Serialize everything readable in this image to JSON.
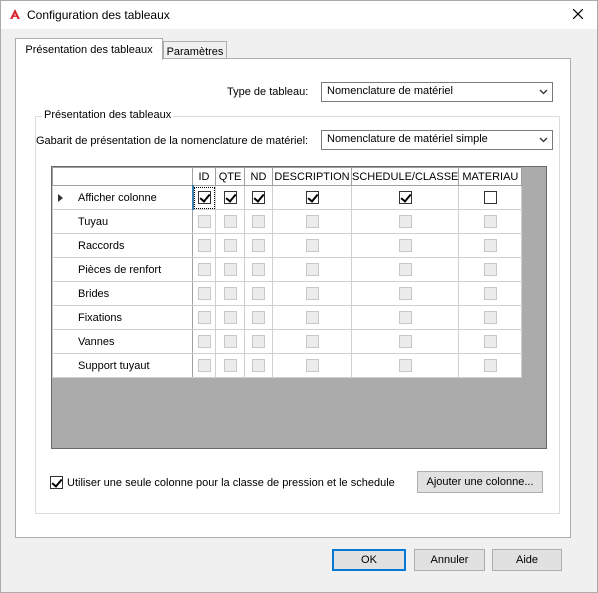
{
  "window": {
    "title": "Configuration des tableaux",
    "icon": "autocad-a-icon"
  },
  "tabs": [
    {
      "label": "Présentation des tableaux",
      "active": true
    },
    {
      "label": "Paramètres",
      "active": false
    }
  ],
  "table_type": {
    "label": "Type de tableau:",
    "value": "Nomenclature de matériel"
  },
  "group": {
    "legend": "Présentation des tableaux",
    "template_label": "Gabarit de présentation de la nomenclature de matériel:",
    "template_value": "Nomenclature de matériel simple"
  },
  "grid": {
    "columns": [
      "ID",
      "QTE",
      "ND",
      "DESCRIPTION",
      "SCHEDULE/CLASSE",
      "MATERIAU"
    ],
    "rows": [
      {
        "label": "Afficher colonne",
        "current": true,
        "enabled": true,
        "checks": [
          true,
          true,
          true,
          true,
          true,
          false
        ]
      },
      {
        "label": "Tuyau",
        "current": false,
        "enabled": false,
        "checks": [
          false,
          false,
          false,
          false,
          false,
          false
        ]
      },
      {
        "label": "Raccords",
        "current": false,
        "enabled": false,
        "checks": [
          false,
          false,
          false,
          false,
          false,
          false
        ]
      },
      {
        "label": "Pièces de renfort",
        "current": false,
        "enabled": false,
        "checks": [
          false,
          false,
          false,
          false,
          false,
          false
        ]
      },
      {
        "label": "Brides",
        "current": false,
        "enabled": false,
        "checks": [
          false,
          false,
          false,
          false,
          false,
          false
        ]
      },
      {
        "label": "Fixations",
        "current": false,
        "enabled": false,
        "checks": [
          false,
          false,
          false,
          false,
          false,
          false
        ]
      },
      {
        "label": "Vannes",
        "current": false,
        "enabled": false,
        "checks": [
          false,
          false,
          false,
          false,
          false,
          false
        ]
      },
      {
        "label": "Support tuyaut",
        "current": false,
        "enabled": false,
        "checks": [
          false,
          false,
          false,
          false,
          false,
          false
        ]
      }
    ]
  },
  "single_column_option": {
    "label": "Utiliser une seule colonne pour la classe de pression et le schedule",
    "checked": true
  },
  "add_column_button": "Ajouter une colonne...",
  "footer": {
    "ok": "OK",
    "cancel": "Annuler",
    "help": "Aide"
  }
}
